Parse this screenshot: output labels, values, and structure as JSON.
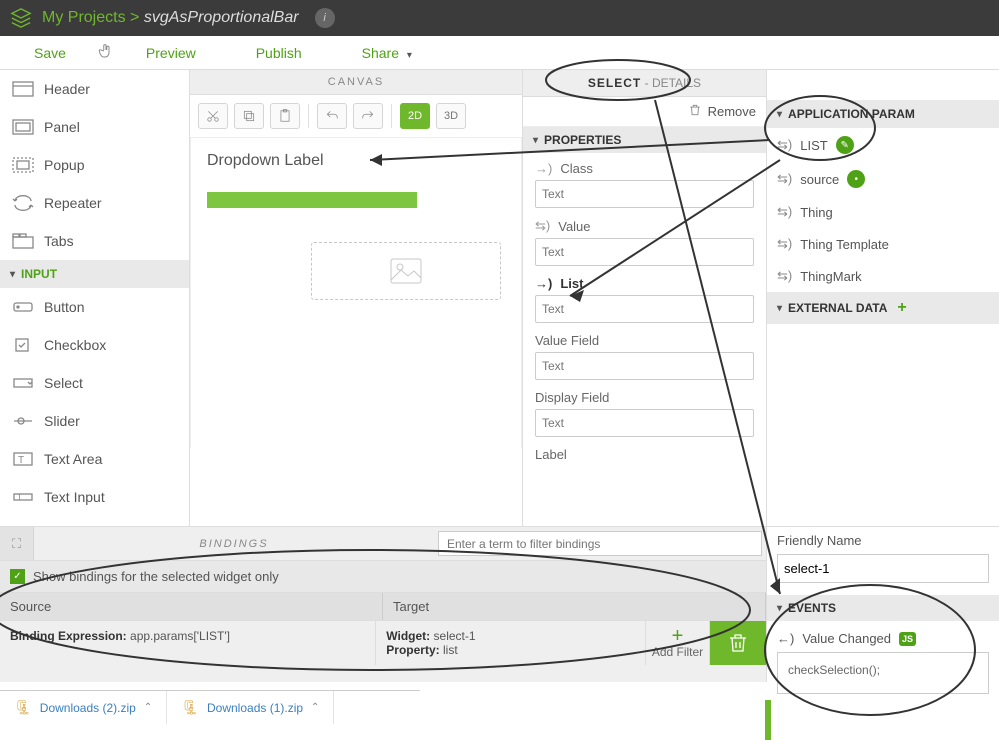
{
  "header": {
    "breadcrumb_root": "My Projects",
    "breadcrumb_sep": ">",
    "breadcrumb_name": "svgAsProportionalBar"
  },
  "menu": {
    "save": "Save",
    "preview": "Preview",
    "publish": "Publish",
    "share": "Share"
  },
  "left_palette": {
    "items_top": [
      {
        "label": "Header"
      },
      {
        "label": "Panel"
      },
      {
        "label": "Popup"
      },
      {
        "label": "Repeater"
      },
      {
        "label": "Tabs"
      }
    ],
    "section_input": "INPUT",
    "items_input": [
      {
        "label": "Button"
      },
      {
        "label": "Checkbox"
      },
      {
        "label": "Select"
      },
      {
        "label": "Slider"
      },
      {
        "label": "Text Area"
      },
      {
        "label": "Text Input"
      }
    ]
  },
  "canvas": {
    "title": "CANVAS",
    "btn2d": "2D",
    "btn3d": "3D",
    "dropdown_label": "Dropdown Label"
  },
  "details": {
    "title_strong": "SELECT",
    "title_rest": "- DETAILS",
    "remove": "Remove",
    "section_props": "PROPERTIES",
    "props": [
      {
        "name": "Class",
        "placeholder": "Text"
      },
      {
        "name": "Value",
        "placeholder": "Text"
      },
      {
        "name": "List",
        "placeholder": "Text"
      },
      {
        "name": "Value Field",
        "placeholder": "Text"
      },
      {
        "name": "Display Field",
        "placeholder": "Text"
      },
      {
        "name": "Label"
      }
    ]
  },
  "data_panel": {
    "section_app": "APPLICATION PARAM",
    "items": [
      {
        "label": "LIST",
        "icon": "pencil"
      },
      {
        "label": "source",
        "icon": "dot"
      },
      {
        "label": "Thing"
      },
      {
        "label": "Thing Template"
      },
      {
        "label": "ThingMark"
      }
    ],
    "section_ext": "EXTERNAL DATA"
  },
  "bindings": {
    "title": "BINDINGS",
    "filter_placeholder": "Enter a term to filter bindings",
    "checkbox_label": "Show bindings for the selected widget only",
    "col_source": "Source",
    "col_target": "Target",
    "row": {
      "source_label": "Binding Expression:",
      "source_value": "app.params['LIST']",
      "target_widget_label": "Widget:",
      "target_widget_value": "select-1",
      "target_prop_label": "Property:",
      "target_prop_value": "list"
    },
    "add_filter": "Add Filter"
  },
  "rightC": {
    "friendly_label": "Friendly Name",
    "friendly_value": "select-1",
    "section_events": "EVENTS",
    "event_name": "Value Changed",
    "event_badge": "JS",
    "event_body": "checkSelection();"
  },
  "downloads": {
    "items": [
      {
        "name": "Downloads (2).zip"
      },
      {
        "name": "Downloads (1).zip"
      }
    ]
  }
}
